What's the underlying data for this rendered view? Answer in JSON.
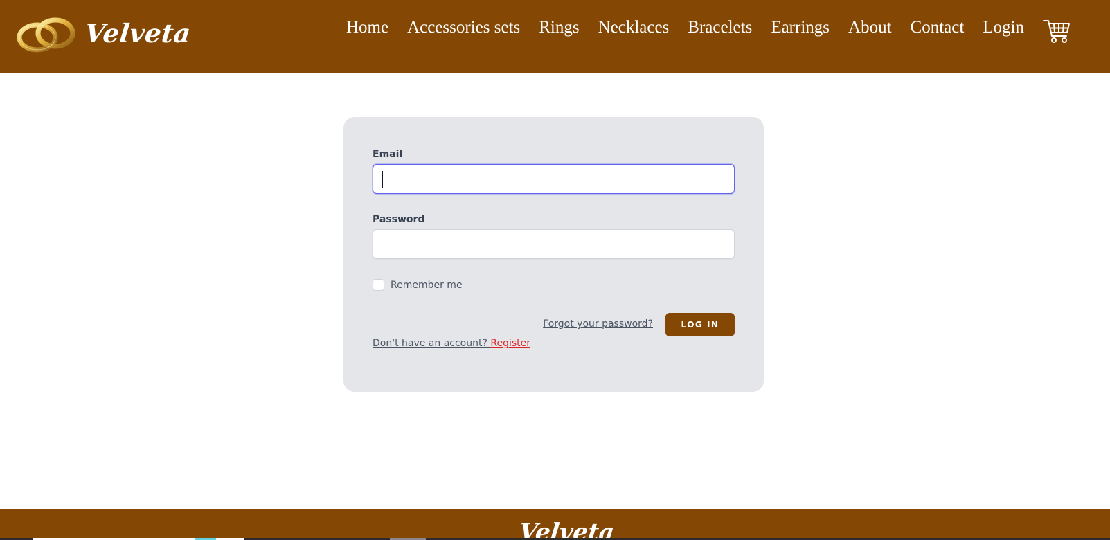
{
  "header": {
    "brand": "Velveta",
    "logo_icon": "wedding-rings-icon",
    "nav": [
      "Home",
      "Accessories sets",
      "Rings",
      "Necklaces",
      "Bracelets",
      "Earrings",
      "About",
      "Contact",
      "Login"
    ],
    "cart_icon": "shopping-cart-icon"
  },
  "form": {
    "email_label": "Email",
    "email_value": "",
    "password_label": "Password",
    "password_value": "",
    "remember_label": "Remember me",
    "remember_checked": false,
    "forgot_link": "Forgot your password?",
    "login_button": "LOG IN",
    "register_prompt": "Don't have an account?",
    "register_link": "Register"
  },
  "footer": {
    "brand": "Velveta"
  },
  "colors": {
    "brand_brown": "#844704",
    "card_bg": "#e5e6ea",
    "focus_ring": "#6366f1",
    "register_red": "#dc2626"
  }
}
